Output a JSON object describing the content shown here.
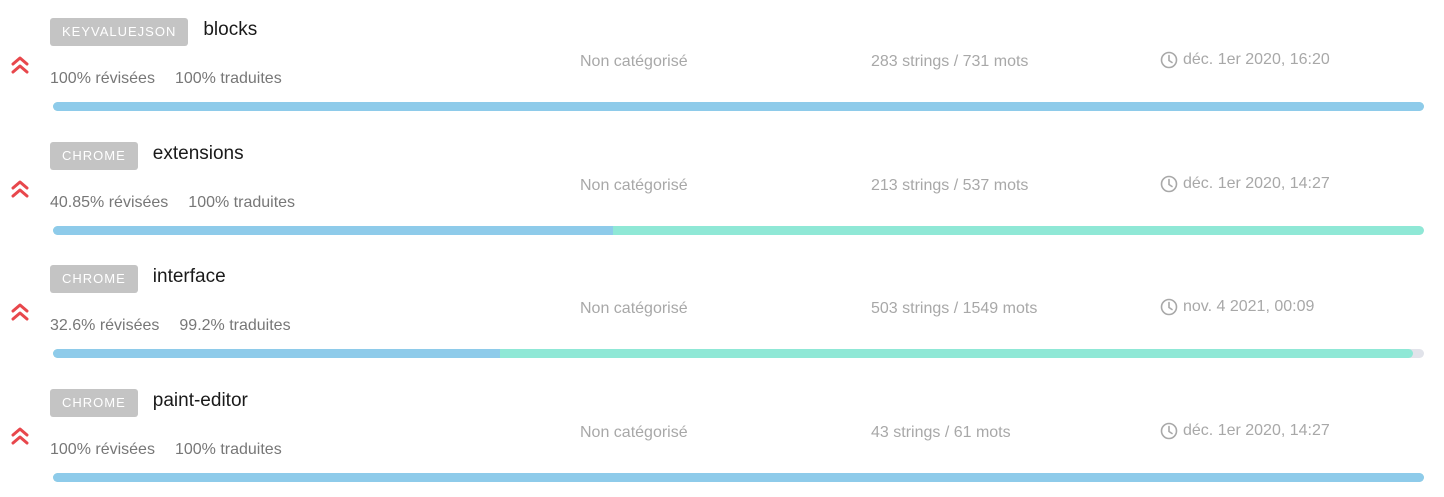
{
  "resources": [
    {
      "type_badge": "KEYVALUEJSON",
      "name": "blocks",
      "reviewed_label": "100% révisées",
      "translated_label": "100% traduites",
      "reviewed_pct": 100,
      "translated_pct": 100,
      "category": "Non catégorisé",
      "counts": "283 strings / 731 mots",
      "date": "déc. 1er 2020, 16:20"
    },
    {
      "type_badge": "CHROME",
      "name": "extensions",
      "reviewed_label": "40.85% révisées",
      "translated_label": "100% traduites",
      "reviewed_pct": 40.85,
      "translated_pct": 100,
      "category": "Non catégorisé",
      "counts": "213 strings / 537 mots",
      "date": "déc. 1er 2020, 14:27"
    },
    {
      "type_badge": "CHROME",
      "name": "interface",
      "reviewed_label": "32.6% révisées",
      "translated_label": "99.2% traduites",
      "reviewed_pct": 32.6,
      "translated_pct": 99.2,
      "category": "Non catégorisé",
      "counts": "503 strings / 1549 mots",
      "date": "nov. 4 2021, 00:09"
    },
    {
      "type_badge": "CHROME",
      "name": "paint-editor",
      "reviewed_label": "100% révisées",
      "translated_label": "100% traduites",
      "reviewed_pct": 100,
      "translated_pct": 100,
      "category": "Non catégorisé",
      "counts": "43 strings / 61 mots",
      "date": "déc. 1er 2020, 14:27"
    }
  ],
  "icons": {
    "priority": "double-chevron-up-icon",
    "time": "clock-icon"
  },
  "colors": {
    "priority": "#e8474c",
    "badge_bg": "#c4c4c4",
    "reviewed_bar": "#8ecbea",
    "translated_bar": "#8fe8d6",
    "track": "#e1e3ea"
  }
}
